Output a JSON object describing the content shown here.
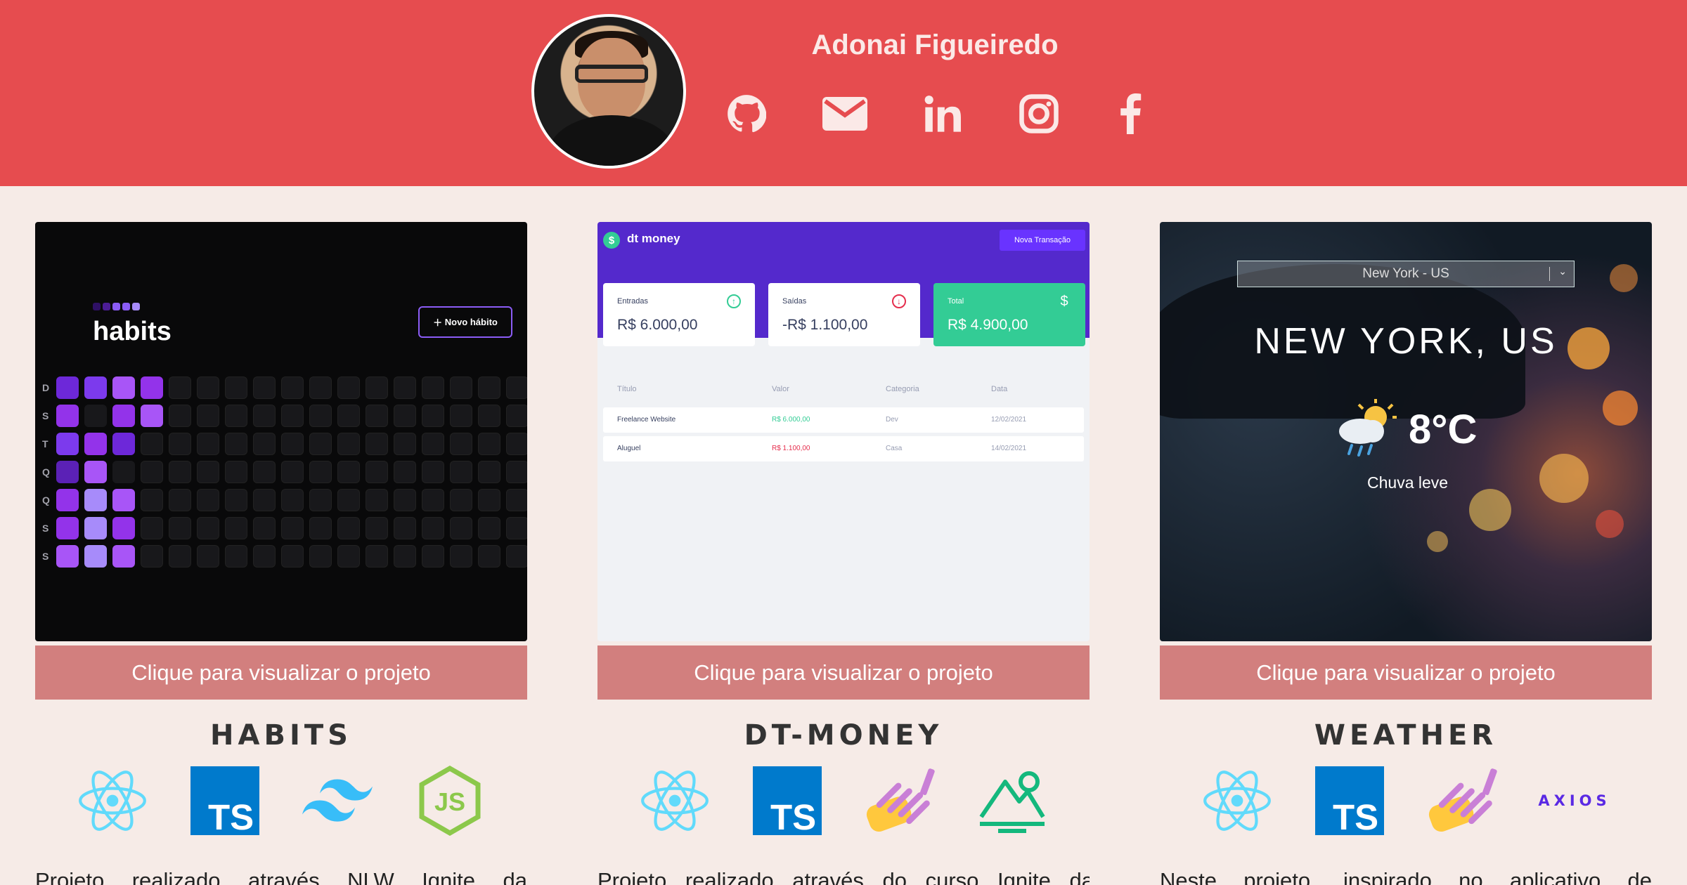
{
  "profile": {
    "name": "Adonai Figueiredo",
    "social": [
      "github-icon",
      "email-icon",
      "linkedin-icon",
      "instagram-icon",
      "facebook-icon"
    ]
  },
  "colors": {
    "header": "#e64c4f",
    "background": "#f6ebe7",
    "button": "#d27f7e"
  },
  "projects": [
    {
      "title": "HABITS",
      "button_label": "Clique para visualizar o projeto",
      "techs": [
        "react-icon",
        "typescript-icon",
        "tailwind-icon",
        "nodejs-icon"
      ],
      "description": "Projeto realizado através NLW Ignite da",
      "preview": {
        "logo": "habits",
        "new_button": "Novo hábito",
        "days": [
          "D",
          "S",
          "T",
          "Q",
          "Q",
          "S",
          "S"
        ]
      }
    },
    {
      "title": "DT-MONEY",
      "button_label": "Clique para visualizar o projeto",
      "techs": [
        "react-icon",
        "typescript-icon",
        "styled-components-icon",
        "vite-icon"
      ],
      "description": "Projeto realizado através do curso Ignite da",
      "preview": {
        "brand": "dt money",
        "new_button": "Nova Transação",
        "summary": [
          {
            "label": "Entradas",
            "value": "R$ 6.000,00"
          },
          {
            "label": "Saídas",
            "value": "-R$ 1.100,00"
          },
          {
            "label": "Total",
            "value": "R$ 4.900,00"
          }
        ],
        "columns": [
          "Título",
          "Valor",
          "Categoria",
          "Data"
        ],
        "rows": [
          [
            "Freelance Website",
            "R$ 6.000,00",
            "Dev",
            "12/02/2021"
          ],
          [
            "Aluguel",
            "R$ 1.100,00",
            "Casa",
            "14/02/2021"
          ]
        ]
      }
    },
    {
      "title": "WEATHER",
      "button_label": "Clique para visualizar o projeto",
      "techs": [
        "react-icon",
        "typescript-icon",
        "styled-components-icon",
        "axios-icon"
      ],
      "axios_label": "AXIOS",
      "description": "Neste projeto, inspirado no aplicativo de",
      "preview": {
        "select": "New York - US",
        "city": "NEW YORK, US",
        "temp": "8°C",
        "condition": "Chuva leve"
      }
    }
  ]
}
